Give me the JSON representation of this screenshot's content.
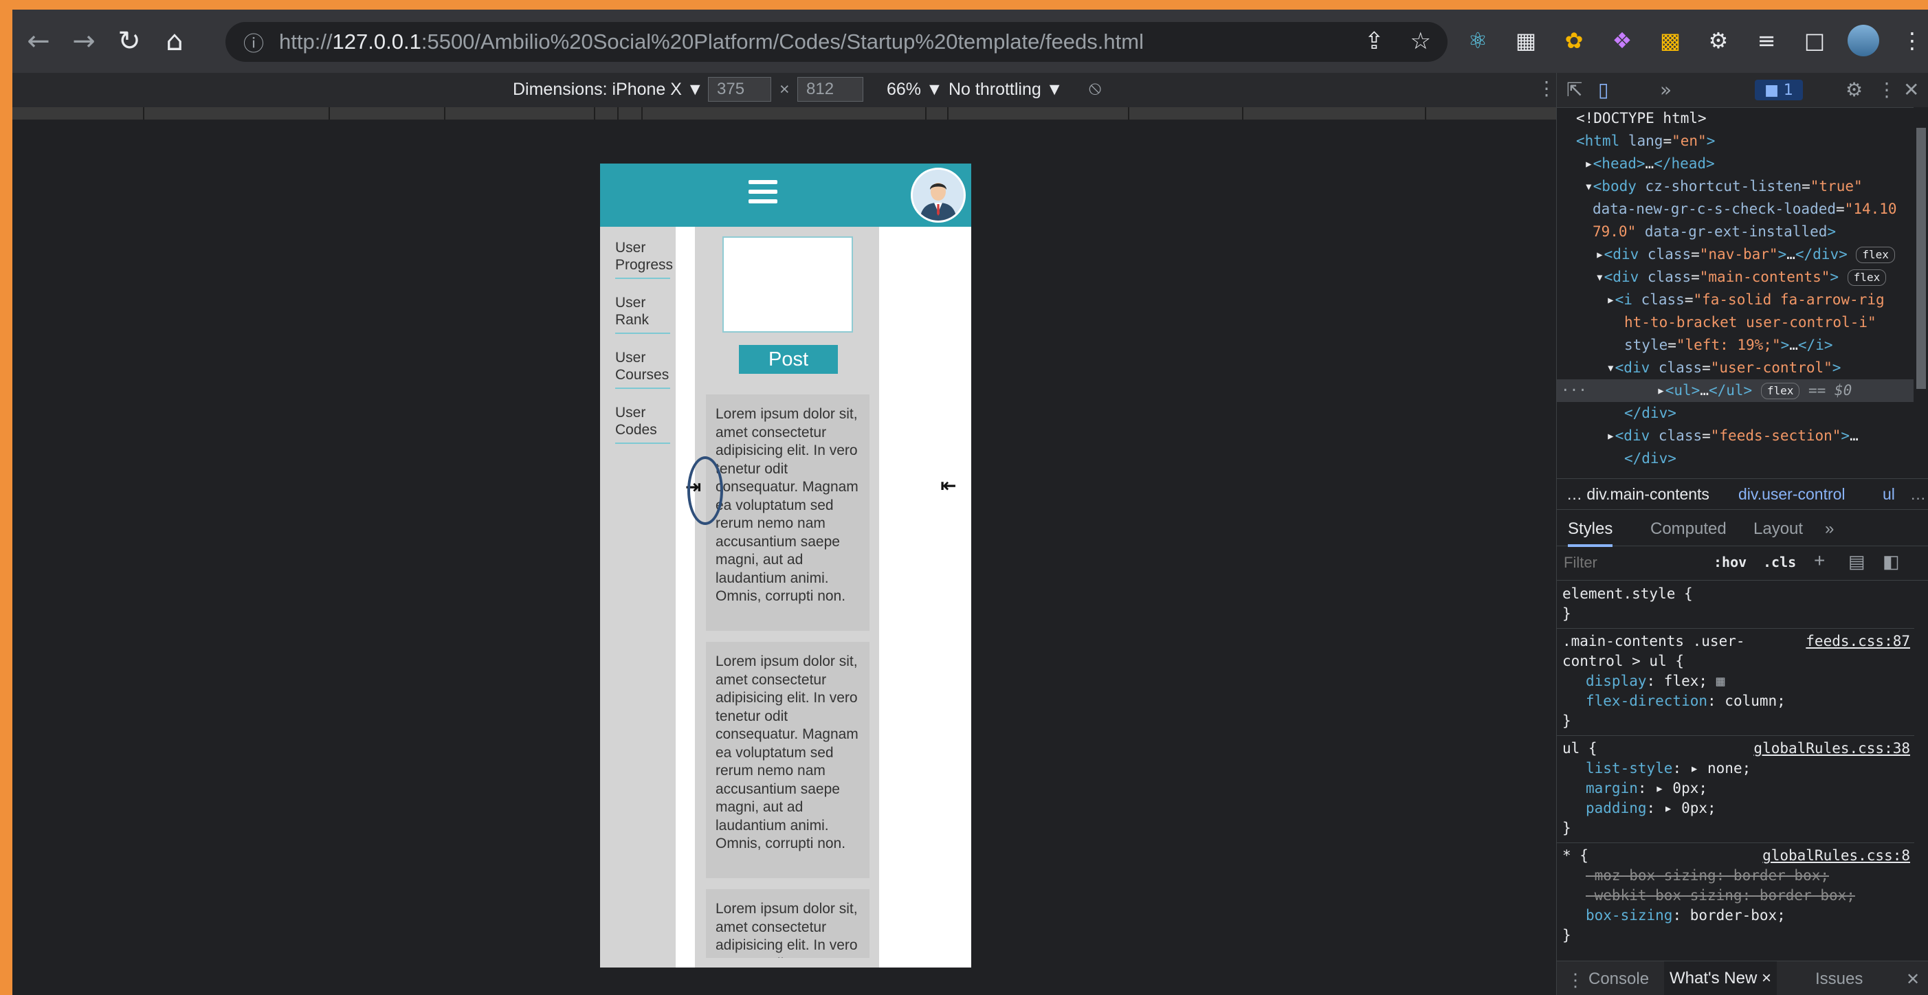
{
  "browser": {
    "url_prefix": "http://",
    "url_host": "127.0.0.1",
    "url_rest": ":5500/Ambilio%20Social%20Platform/Codes/Startup%20template/feeds.html"
  },
  "device_toolbar": {
    "dimensions": "Dimensions: iPhone X ▼",
    "width": "375",
    "times": "×",
    "height": "812",
    "zoom": "66% ▼",
    "throttling": "No throttling ▼"
  },
  "page": {
    "user_control": [
      "User Progress",
      "User Rank",
      "User Courses",
      "User Codes"
    ],
    "post_button": "Post",
    "feed_text": "Lorem ipsum dolor sit, amet consectetur adipisicing elit. In vero tenetur odit consequatur. Magnam ea voluptatum sed rerum nemo nam accusantium saepe magni, aut ad laudantium animi. Omnis, corrupti non."
  },
  "devtools": {
    "issues_badge": "1",
    "breadcrumb": [
      "… div.main-contents",
      "div.user-control",
      "ul",
      "…"
    ],
    "tabs": [
      "Styles",
      "Computed",
      "Layout",
      "»"
    ],
    "filter_placeholder": "Filter",
    "filter_hov": ":hov",
    "filter_cls": ".cls",
    "drawer_tabs": [
      "Console",
      "What's New ×",
      "Issues"
    ],
    "sources": {
      "feeds": "feeds.css:87",
      "global38": "globalRules.css:38",
      "global8": "globalRules.css:8"
    }
  }
}
